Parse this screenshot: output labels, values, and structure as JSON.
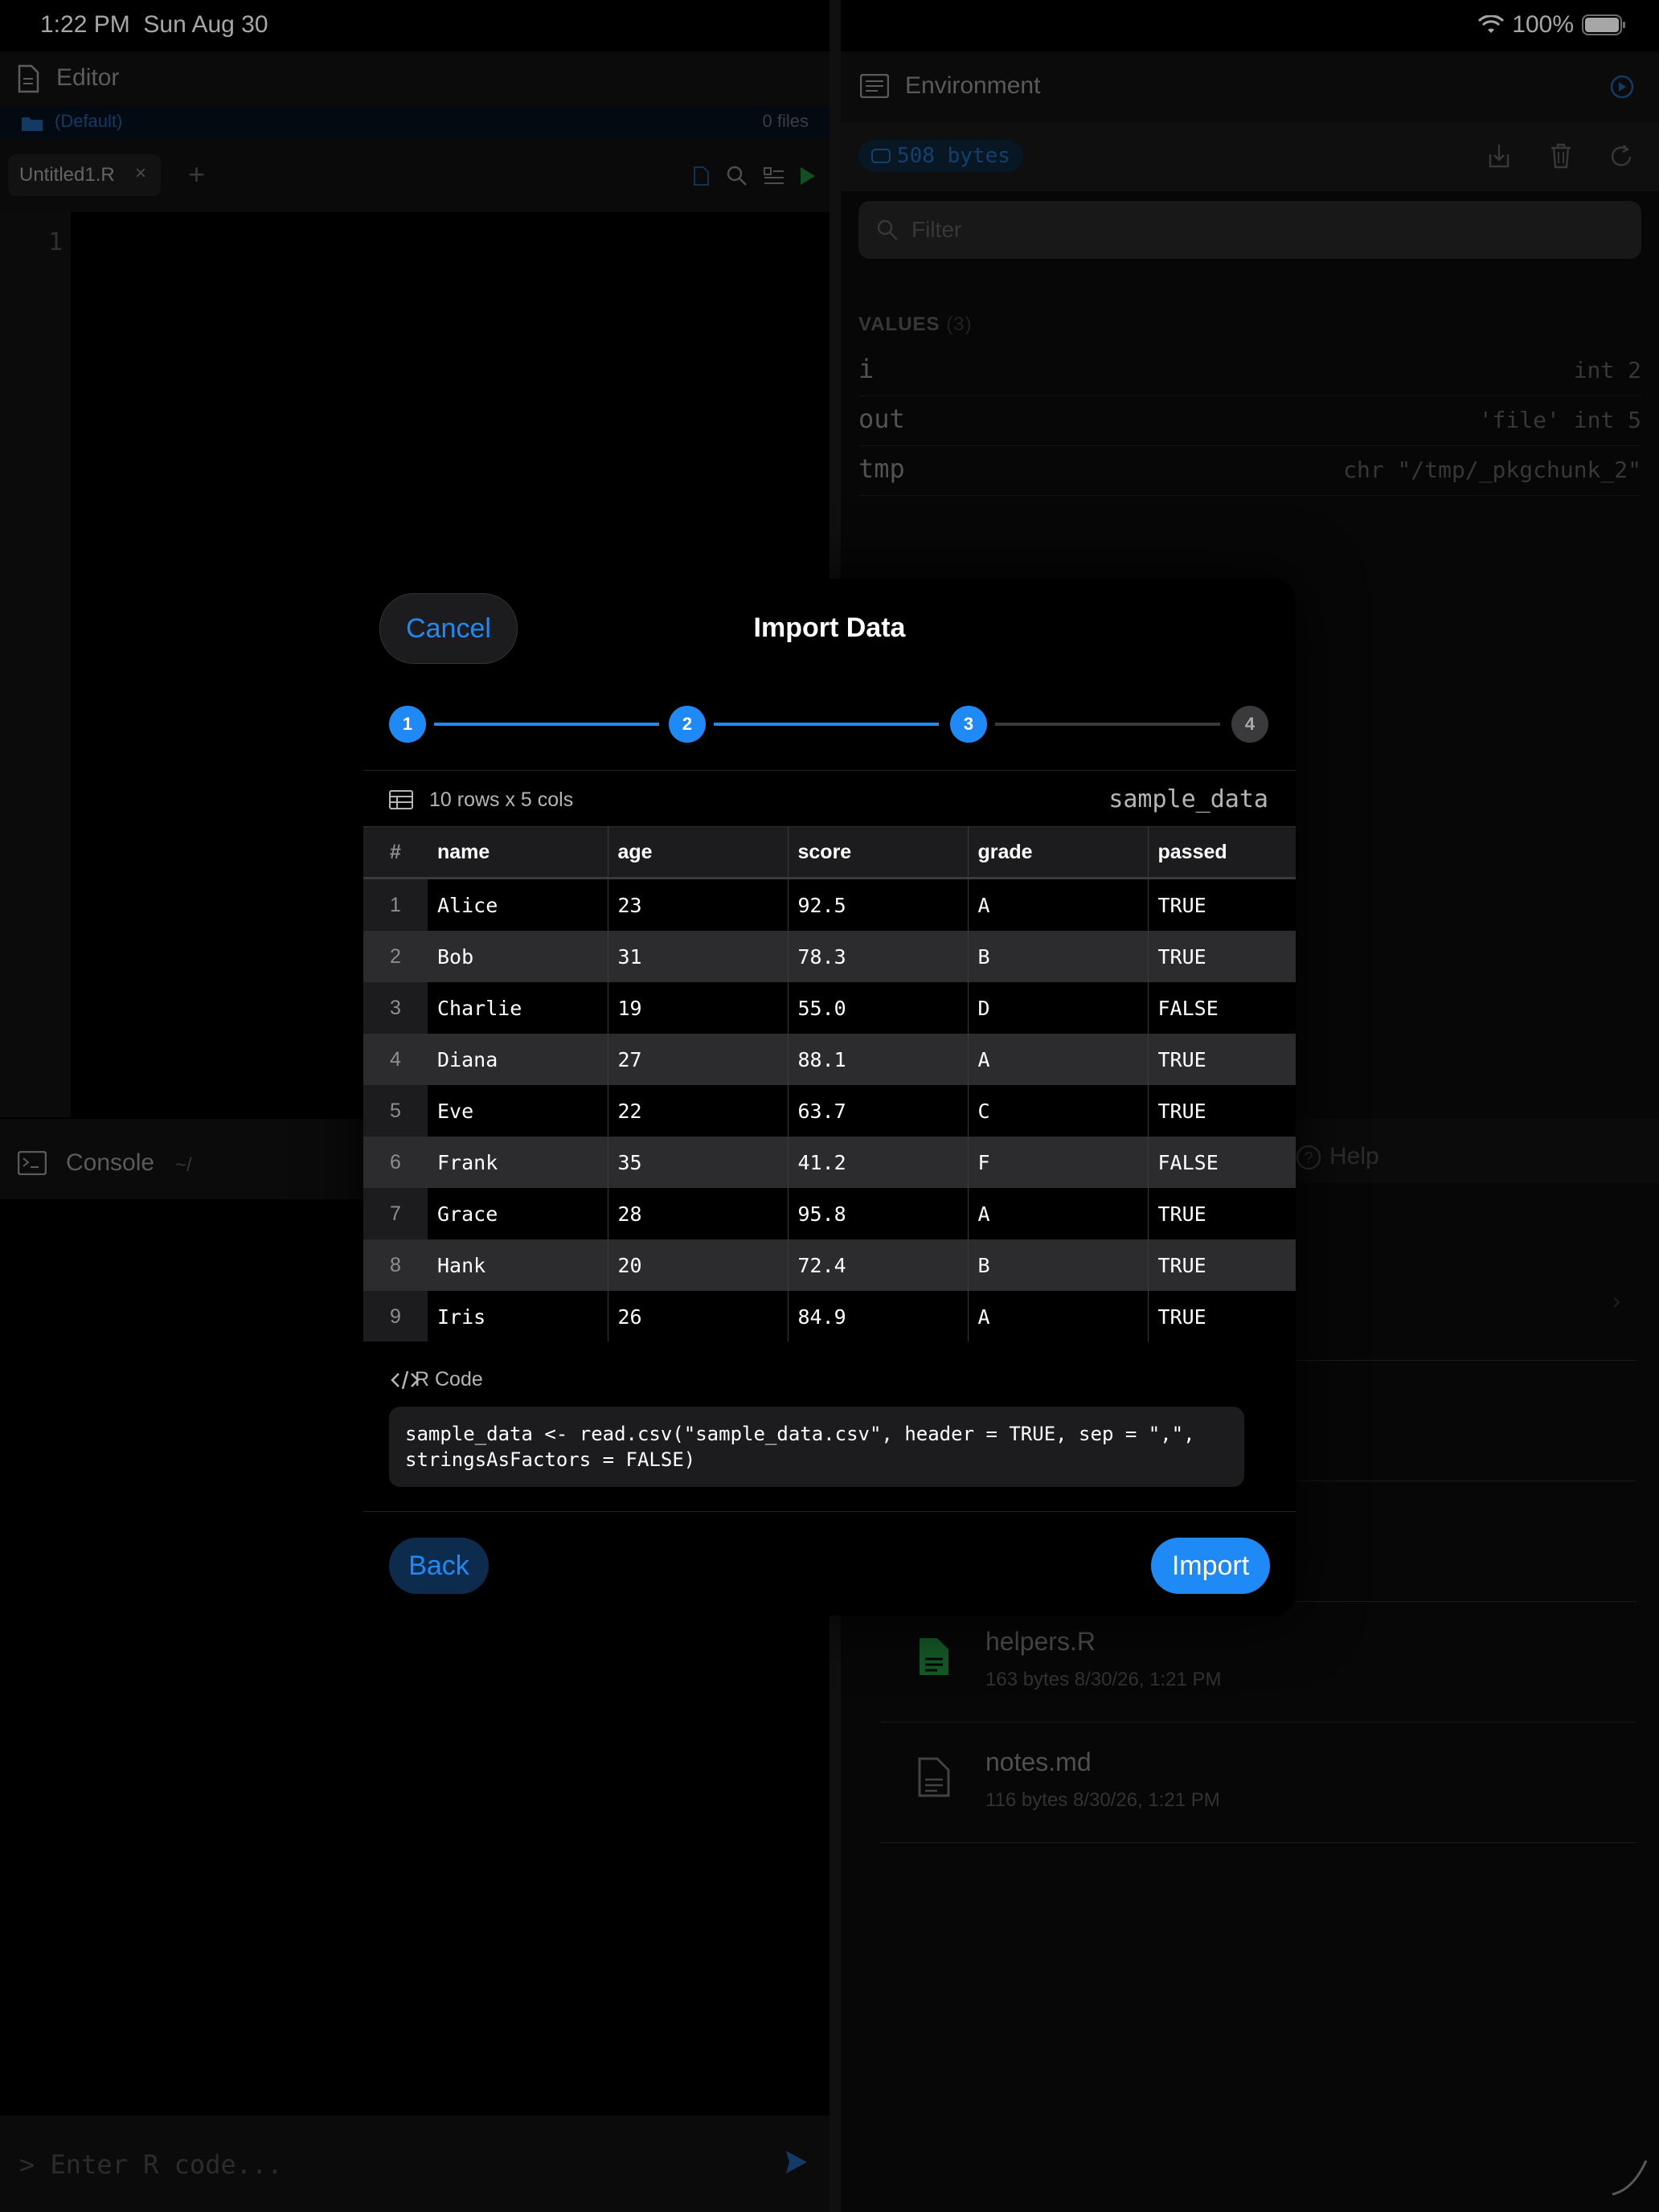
{
  "status_bar": {
    "time": "1:22 PM",
    "date": "Sun Aug 30",
    "battery": "100%"
  },
  "editor": {
    "title": "Editor",
    "project": "(Default)",
    "file_count": "0 files",
    "tab_label": "Untitled1.R",
    "line_number": "1"
  },
  "environment": {
    "title": "Environment",
    "memory": "508 bytes",
    "filter_placeholder": "Filter",
    "values_label": "VALUES",
    "values_count": "(3)",
    "values": [
      {
        "name": "i",
        "value": "int 2"
      },
      {
        "name": "out",
        "value": "'file' int 5"
      },
      {
        "name": "tmp",
        "value": "chr \"/tmp/_pkgchunk_2\""
      }
    ]
  },
  "console": {
    "title": "Console",
    "path": "~/",
    "placeholder": "> Enter R code..."
  },
  "files_pane": {
    "help_tab": "Help",
    "files": [
      {
        "name": "helpers.R",
        "meta": "163 bytes  8/30/26, 1:21 PM",
        "icon": "r-file-icon"
      },
      {
        "name": "notes.md",
        "meta": "116 bytes  8/30/26, 1:21 PM",
        "icon": "document-icon"
      }
    ]
  },
  "modal": {
    "title": "Import Data",
    "cancel": "Cancel",
    "steps": [
      "1",
      "2",
      "3",
      "4"
    ],
    "current_step": 3,
    "table_dims": "10 rows x 5 cols",
    "dataset_name": "sample_data",
    "columns": [
      "#",
      "name",
      "age",
      "score",
      "grade",
      "passed"
    ],
    "rows": [
      [
        "1",
        "Alice",
        "23",
        "92.5",
        "A",
        "TRUE"
      ],
      [
        "2",
        "Bob",
        "31",
        "78.3",
        "B",
        "TRUE"
      ],
      [
        "3",
        "Charlie",
        "19",
        "55.0",
        "D",
        "FALSE"
      ],
      [
        "4",
        "Diana",
        "27",
        "88.1",
        "A",
        "TRUE"
      ],
      [
        "5",
        "Eve",
        "22",
        "63.7",
        "C",
        "TRUE"
      ],
      [
        "6",
        "Frank",
        "35",
        "41.2",
        "F",
        "FALSE"
      ],
      [
        "7",
        "Grace",
        "28",
        "95.8",
        "A",
        "TRUE"
      ],
      [
        "8",
        "Hank",
        "20",
        "72.4",
        "B",
        "TRUE"
      ],
      [
        "9",
        "Iris",
        "26",
        "84.9",
        "A",
        "TRUE"
      ]
    ],
    "rcode_label": "R Code",
    "rcode": "sample_data <- read.csv(\"sample_data.csv\", header = TRUE, sep = \",\",\nstringsAsFactors = FALSE)",
    "back": "Back",
    "import": "Import"
  },
  "colors": {
    "accent": "#1f8af5",
    "modal_bg": "#000000",
    "row_alt": "#2c2c2e",
    "r_file": "#2aa84a"
  }
}
